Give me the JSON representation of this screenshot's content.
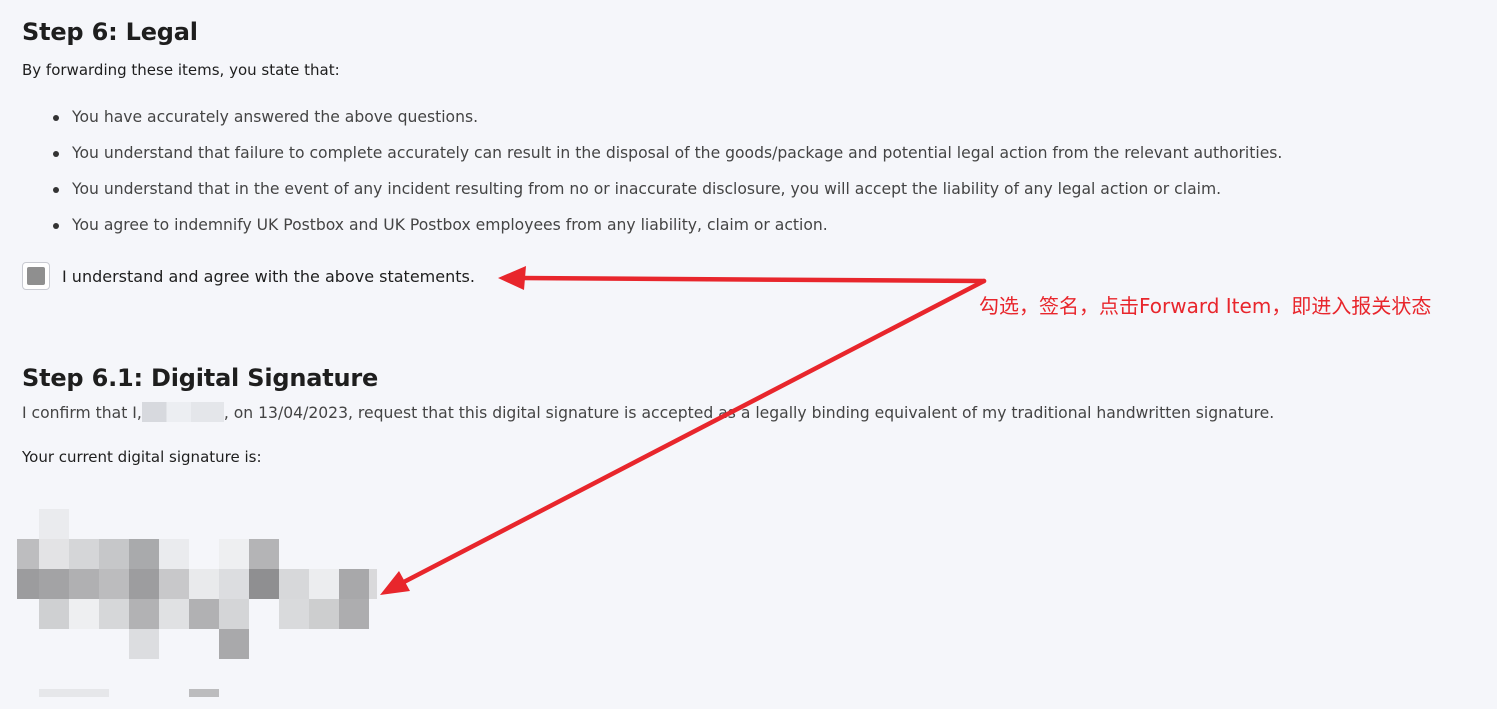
{
  "legal": {
    "title": "Step 6: Legal",
    "intro": "By forwarding these items, you state that:",
    "statements": [
      "You have accurately answered the above questions.",
      "You understand that failure to complete accurately can result in the disposal of the goods/package and potential legal action from the relevant authorities.",
      "You understand that in the event of any incident resulting from no or inaccurate disclosure, you will accept the liability of any legal action or claim.",
      "You agree to indemnify UK Postbox and UK Postbox employees from any liability, claim or action."
    ],
    "agree_label": "I understand and agree with the above statements.",
    "agree_checked": true
  },
  "signature_section": {
    "title": "Step 6.1: Digital Signature",
    "confirm_prefix": "I confirm that I,",
    "confirm_suffix": ", on 13/04/2023, request that this digital signature is accepted as a legally binding equivalent of my traditional handwritten signature.",
    "current_label": "Your current digital signature is:",
    "signature_redacted": true
  },
  "annotation": {
    "text": "勾选，签名，点击Forward Item，即进入报关状态",
    "color": "#e8262c"
  }
}
